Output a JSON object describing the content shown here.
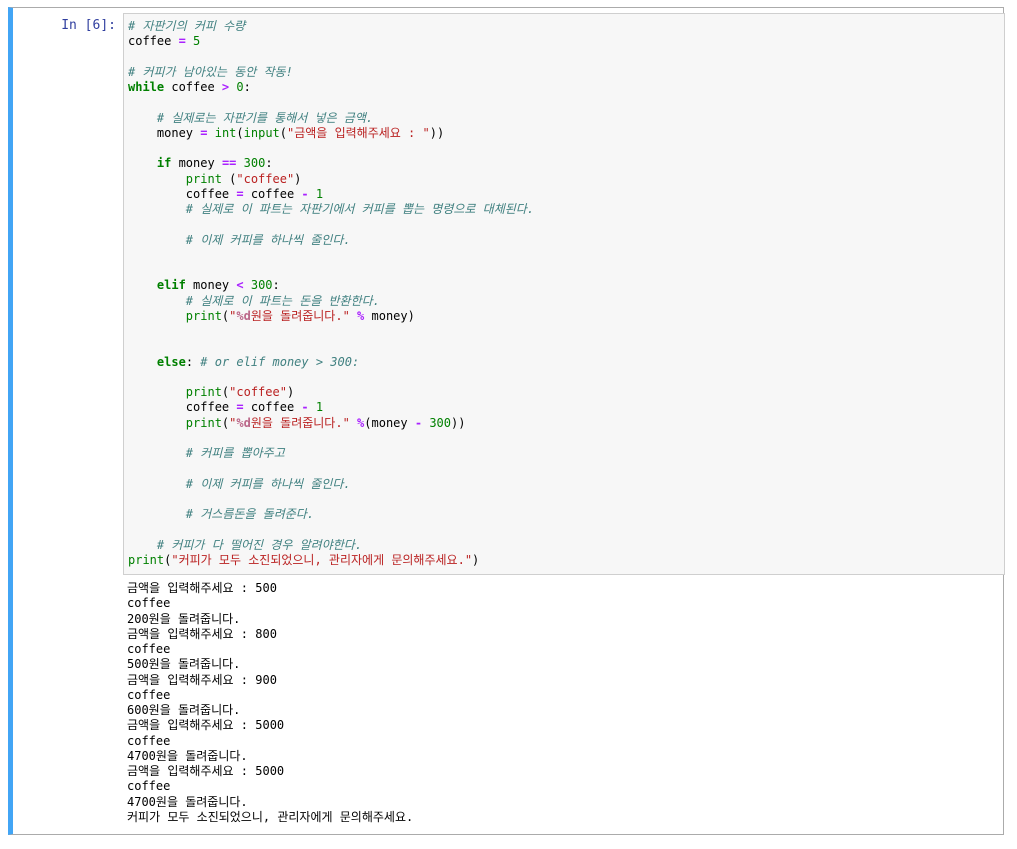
{
  "cell": {
    "prompt": "In [6]:"
  },
  "code_lines": [
    [
      [
        "c",
        "# 자판기의 커피 수량"
      ]
    ],
    [
      [
        "",
        "coffee "
      ],
      [
        "o",
        "="
      ],
      [
        "",
        " "
      ],
      [
        "n",
        "5"
      ]
    ],
    [],
    [
      [
        "c",
        "# 커피가 남아있는 동안 작동!"
      ]
    ],
    [
      [
        "k",
        "while"
      ],
      [
        "",
        " coffee "
      ],
      [
        "o",
        ">"
      ],
      [
        "",
        " "
      ],
      [
        "n",
        "0"
      ],
      [
        "",
        ":"
      ]
    ],
    [],
    [
      [
        "",
        "    "
      ],
      [
        "c",
        "# 실제로는 자판기를 통해서 넣은 금액."
      ]
    ],
    [
      [
        "",
        "    money "
      ],
      [
        "o",
        "="
      ],
      [
        "",
        " "
      ],
      [
        "b",
        "int"
      ],
      [
        "",
        "("
      ],
      [
        "b",
        "input"
      ],
      [
        "",
        "("
      ],
      [
        "s",
        "\"금액을 입력해주세요 : \""
      ],
      [
        "",
        "))"
      ]
    ],
    [],
    [
      [
        "",
        "    "
      ],
      [
        "k",
        "if"
      ],
      [
        "",
        " money "
      ],
      [
        "o",
        "=="
      ],
      [
        "",
        " "
      ],
      [
        "n",
        "300"
      ],
      [
        "",
        ":"
      ]
    ],
    [
      [
        "",
        "        "
      ],
      [
        "b",
        "print"
      ],
      [
        "",
        " ("
      ],
      [
        "s",
        "\"coffee\""
      ],
      [
        "",
        ")"
      ]
    ],
    [
      [
        "",
        "        coffee "
      ],
      [
        "o",
        "="
      ],
      [
        "",
        " coffee "
      ],
      [
        "o",
        "-"
      ],
      [
        "",
        " "
      ],
      [
        "n",
        "1"
      ]
    ],
    [
      [
        "",
        "        "
      ],
      [
        "c",
        "# 실제로 이 파트는 자판기에서 커피를 뽑는 명령으로 대체된다."
      ]
    ],
    [],
    [
      [
        "",
        "        "
      ],
      [
        "c",
        "# 이제 커피를 하나씩 줄인다."
      ]
    ],
    [],
    [],
    [
      [
        "",
        "    "
      ],
      [
        "k",
        "elif"
      ],
      [
        "",
        " money "
      ],
      [
        "o",
        "<"
      ],
      [
        "",
        " "
      ],
      [
        "n",
        "300"
      ],
      [
        "",
        ":"
      ]
    ],
    [
      [
        "",
        "        "
      ],
      [
        "c",
        "# 실제로 이 파트는 돈을 반환한다."
      ]
    ],
    [
      [
        "",
        "        "
      ],
      [
        "b",
        "print"
      ],
      [
        "",
        "("
      ],
      [
        "s",
        "\""
      ],
      [
        "si",
        "%d"
      ],
      [
        "s",
        "원을 돌려줍니다.\""
      ],
      [
        "",
        " "
      ],
      [
        "o",
        "%"
      ],
      [
        "",
        " money)"
      ]
    ],
    [],
    [],
    [
      [
        "",
        "    "
      ],
      [
        "k",
        "else"
      ],
      [
        "",
        ": "
      ],
      [
        "c",
        "# or elif money > 300:"
      ]
    ],
    [],
    [
      [
        "",
        "        "
      ],
      [
        "b",
        "print"
      ],
      [
        "",
        "("
      ],
      [
        "s",
        "\"coffee\""
      ],
      [
        "",
        ")"
      ]
    ],
    [
      [
        "",
        "        coffee "
      ],
      [
        "o",
        "="
      ],
      [
        "",
        " coffee "
      ],
      [
        "o",
        "-"
      ],
      [
        "",
        " "
      ],
      [
        "n",
        "1"
      ]
    ],
    [
      [
        "",
        "        "
      ],
      [
        "b",
        "print"
      ],
      [
        "",
        "("
      ],
      [
        "s",
        "\""
      ],
      [
        "si",
        "%d"
      ],
      [
        "s",
        "원을 돌려줍니다.\""
      ],
      [
        "",
        " "
      ],
      [
        "o",
        "%"
      ],
      [
        "",
        "(money "
      ],
      [
        "o",
        "-"
      ],
      [
        "",
        " "
      ],
      [
        "n",
        "300"
      ],
      [
        "",
        "))"
      ]
    ],
    [],
    [
      [
        "",
        "        "
      ],
      [
        "c",
        "# 커피를 뽑아주고"
      ]
    ],
    [],
    [
      [
        "",
        "        "
      ],
      [
        "c",
        "# 이제 커피를 하나씩 줄인다."
      ]
    ],
    [],
    [
      [
        "",
        "        "
      ],
      [
        "c",
        "# 거스름돈을 돌려준다."
      ]
    ],
    [],
    [
      [
        "",
        "    "
      ],
      [
        "c",
        "# 커피가 다 떨어진 경우 알려야한다."
      ]
    ],
    [
      [
        "b",
        "print"
      ],
      [
        "",
        "("
      ],
      [
        "s",
        "\"커피가 모두 소진되었으니, 관리자에게 문의해주세요.\""
      ],
      [
        "",
        ")"
      ]
    ]
  ],
  "output_lines": [
    "금액을 입력해주세요 : 500",
    "coffee",
    "200원을 돌려줍니다.",
    "금액을 입력해주세요 : 800",
    "coffee",
    "500원을 돌려줍니다.",
    "금액을 입력해주세요 : 900",
    "coffee",
    "600원을 돌려줍니다.",
    "금액을 입력해주세요 : 5000",
    "coffee",
    "4700원을 돌려줍니다.",
    "금액을 입력해주세요 : 5000",
    "coffee",
    "4700원을 돌려줍니다.",
    "커피가 모두 소진되었으니, 관리자에게 문의해주세요."
  ]
}
